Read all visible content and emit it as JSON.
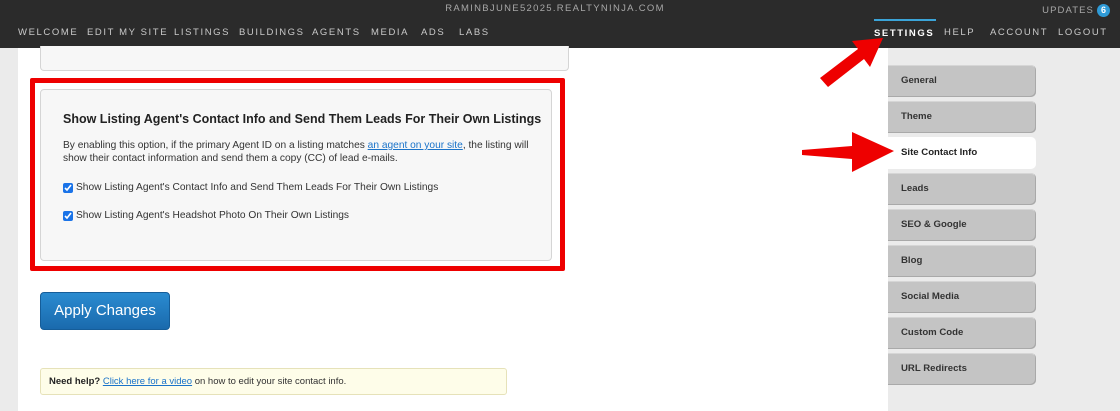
{
  "topbar": {
    "site_domain": "RAMINBJUNE52025.REALTYNINJA.COM",
    "updates_label": "UPDATES",
    "updates_count": "6",
    "nav_left": [
      "WELCOME",
      "EDIT MY SITE",
      "LISTINGS",
      "BUILDINGS",
      "AGENTS",
      "MEDIA",
      "ADS",
      "LABS"
    ],
    "nav_right": [
      "SETTINGS",
      "HELP",
      "ACCOUNT",
      "LOGOUT"
    ],
    "active": "SETTINGS"
  },
  "section": {
    "title": "Show Listing Agent's Contact Info and Send Them Leads For Their Own Listings",
    "desc_before": "By enabling this option, if the primary Agent ID on a listing matches ",
    "desc_link": "an agent on your site",
    "desc_after": ", the listing will show their contact information and send them a copy (CC) of lead e-mails.",
    "checkboxes": [
      {
        "label": "Show Listing Agent's Contact Info and Send Them Leads For Their Own Listings",
        "checked": true
      },
      {
        "label": "Show Listing Agent's Headshot Photo On Their Own Listings",
        "checked": true
      }
    ]
  },
  "apply_button": "Apply Changes",
  "help": {
    "strong": "Need help?",
    "link": "Click here for a video",
    "rest": " on how to edit your site contact info."
  },
  "sidebar": {
    "items": [
      "General",
      "Theme",
      "Site Contact Info",
      "Leads",
      "SEO & Google",
      "Blog",
      "Social Media",
      "Custom Code",
      "URL Redirects"
    ],
    "active": "Site Contact Info"
  },
  "colors": {
    "accent": "#2e9ad6",
    "highlight": "#ee0000",
    "topbar": "#2b2b2b"
  }
}
